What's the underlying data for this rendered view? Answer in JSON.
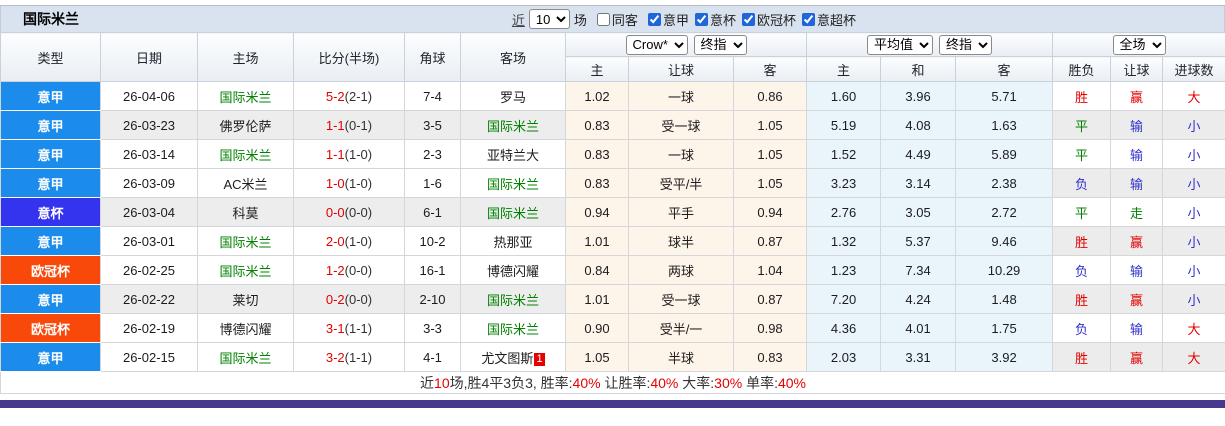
{
  "title": "国际米兰",
  "controls": {
    "recent_label": "近",
    "matches_select": "10",
    "matches_label": "场",
    "same_venue_label": "同客",
    "same_venue_checked": false,
    "leagues": [
      {
        "label": "意甲",
        "checked": true
      },
      {
        "label": "意杯",
        "checked": true
      },
      {
        "label": "欧冠杯",
        "checked": true
      },
      {
        "label": "意超杯",
        "checked": true
      }
    ]
  },
  "header": {
    "static_cols": [
      "类型",
      "日期",
      "主场",
      "比分(半场)",
      "角球",
      "客场"
    ],
    "odds_group": {
      "bookmaker_select": "Crow*",
      "stage_select": "终指",
      "cols": [
        "主",
        "让球",
        "客"
      ]
    },
    "europe_group": {
      "avg_select": "平均值",
      "stage_select": "终指",
      "cols": [
        "主",
        "和",
        "客"
      ]
    },
    "result_group": {
      "scope_select": "全场",
      "cols": [
        "胜负",
        "让球",
        "进球数"
      ]
    }
  },
  "colors": {
    "red": "#e40000",
    "green": "#008000",
    "blue": "#3030cc",
    "league_serie_a": "#1b8ceb",
    "league_coppa": "#3434ee",
    "league_ucl": "#f8490b",
    "bottom_bar": "#473a8c"
  },
  "rows": [
    {
      "league": "意甲",
      "league_color": "#1b8ceb",
      "date": "26-04-06",
      "home": "国际米兰",
      "home_team": true,
      "score": "5-2",
      "half": "(2-1)",
      "corner": "7-4",
      "away": "罗马",
      "away_team": false,
      "away_rank": "",
      "crow": [
        "1.02",
        "一球",
        "0.86"
      ],
      "avg": [
        "1.60",
        "3.96",
        "5.71"
      ],
      "results": [
        {
          "text": "胜",
          "color": "#e40000"
        },
        {
          "text": "赢",
          "color": "#e40000"
        },
        {
          "text": "大",
          "color": "#e40000"
        }
      ]
    },
    {
      "league": "意甲",
      "league_color": "#1b8ceb",
      "date": "26-03-23",
      "home": "佛罗伦萨",
      "home_team": false,
      "score": "1-1",
      "half": "(0-1)",
      "corner": "3-5",
      "away": "国际米兰",
      "away_team": true,
      "away_rank": "",
      "crow": [
        "0.83",
        "受一球",
        "1.05"
      ],
      "avg": [
        "5.19",
        "4.08",
        "1.63"
      ],
      "results": [
        {
          "text": "平",
          "color": "#008000"
        },
        {
          "text": "输",
          "color": "#3030cc"
        },
        {
          "text": "小",
          "color": "#3030cc"
        }
      ]
    },
    {
      "league": "意甲",
      "league_color": "#1b8ceb",
      "date": "26-03-14",
      "home": "国际米兰",
      "home_team": true,
      "score": "1-1",
      "half": "(1-0)",
      "corner": "2-3",
      "away": "亚特兰大",
      "away_team": false,
      "away_rank": "",
      "crow": [
        "0.83",
        "一球",
        "1.05"
      ],
      "avg": [
        "1.52",
        "4.49",
        "5.89"
      ],
      "results": [
        {
          "text": "平",
          "color": "#008000"
        },
        {
          "text": "输",
          "color": "#3030cc"
        },
        {
          "text": "小",
          "color": "#3030cc"
        }
      ]
    },
    {
      "league": "意甲",
      "league_color": "#1b8ceb",
      "date": "26-03-09",
      "home": "AC米兰",
      "home_team": false,
      "score": "1-0",
      "half": "(1-0)",
      "corner": "1-6",
      "away": "国际米兰",
      "away_team": true,
      "away_rank": "",
      "crow": [
        "0.83",
        "受平/半",
        "1.05"
      ],
      "avg": [
        "3.23",
        "3.14",
        "2.38"
      ],
      "results": [
        {
          "text": "负",
          "color": "#3030cc"
        },
        {
          "text": "输",
          "color": "#3030cc"
        },
        {
          "text": "小",
          "color": "#3030cc"
        }
      ]
    },
    {
      "league": "意杯",
      "league_color": "#3434ee",
      "date": "26-03-04",
      "home": "科莫",
      "home_team": false,
      "score": "0-0",
      "half": "(0-0)",
      "corner": "6-1",
      "away": "国际米兰",
      "away_team": true,
      "away_rank": "",
      "crow": [
        "0.94",
        "平手",
        "0.94"
      ],
      "avg": [
        "2.76",
        "3.05",
        "2.72"
      ],
      "results": [
        {
          "text": "平",
          "color": "#008000"
        },
        {
          "text": "走",
          "color": "#008000"
        },
        {
          "text": "小",
          "color": "#3030cc"
        }
      ]
    },
    {
      "league": "意甲",
      "league_color": "#1b8ceb",
      "date": "26-03-01",
      "home": "国际米兰",
      "home_team": true,
      "score": "2-0",
      "half": "(1-0)",
      "corner": "10-2",
      "away": "热那亚",
      "away_team": false,
      "away_rank": "",
      "crow": [
        "1.01",
        "球半",
        "0.87"
      ],
      "avg": [
        "1.32",
        "5.37",
        "9.46"
      ],
      "results": [
        {
          "text": "胜",
          "color": "#e40000"
        },
        {
          "text": "赢",
          "color": "#e40000"
        },
        {
          "text": "小",
          "color": "#3030cc"
        }
      ]
    },
    {
      "league": "欧冠杯",
      "league_color": "#f8490b",
      "date": "26-02-25",
      "home": "国际米兰",
      "home_team": true,
      "score": "1-2",
      "half": "(0-0)",
      "corner": "16-1",
      "away": "博德闪耀",
      "away_team": false,
      "away_rank": "",
      "crow": [
        "0.84",
        "两球",
        "1.04"
      ],
      "avg": [
        "1.23",
        "7.34",
        "10.29"
      ],
      "results": [
        {
          "text": "负",
          "color": "#3030cc"
        },
        {
          "text": "输",
          "color": "#3030cc"
        },
        {
          "text": "小",
          "color": "#3030cc"
        }
      ]
    },
    {
      "league": "意甲",
      "league_color": "#1b8ceb",
      "date": "26-02-22",
      "home": "莱切",
      "home_team": false,
      "score": "0-2",
      "half": "(0-0)",
      "corner": "2-10",
      "away": "国际米兰",
      "away_team": true,
      "away_rank": "",
      "crow": [
        "1.01",
        "受一球",
        "0.87"
      ],
      "avg": [
        "7.20",
        "4.24",
        "1.48"
      ],
      "results": [
        {
          "text": "胜",
          "color": "#e40000"
        },
        {
          "text": "赢",
          "color": "#e40000"
        },
        {
          "text": "小",
          "color": "#3030cc"
        }
      ]
    },
    {
      "league": "欧冠杯",
      "league_color": "#f8490b",
      "date": "26-02-19",
      "home": "博德闪耀",
      "home_team": false,
      "score": "3-1",
      "half": "(1-1)",
      "corner": "3-3",
      "away": "国际米兰",
      "away_team": true,
      "away_rank": "",
      "crow": [
        "0.90",
        "受半/一",
        "0.98"
      ],
      "avg": [
        "4.36",
        "4.01",
        "1.75"
      ],
      "results": [
        {
          "text": "负",
          "color": "#3030cc"
        },
        {
          "text": "输",
          "color": "#3030cc"
        },
        {
          "text": "大",
          "color": "#e40000"
        }
      ]
    },
    {
      "league": "意甲",
      "league_color": "#1b8ceb",
      "date": "26-02-15",
      "home": "国际米兰",
      "home_team": true,
      "score": "3-2",
      "half": "(1-1)",
      "corner": "4-1",
      "away": "尤文图斯",
      "away_team": false,
      "away_rank": "1",
      "crow": [
        "1.05",
        "半球",
        "0.83"
      ],
      "avg": [
        "2.03",
        "3.31",
        "3.92"
      ],
      "results": [
        {
          "text": "胜",
          "color": "#e40000"
        },
        {
          "text": "赢",
          "color": "#e40000"
        },
        {
          "text": "大",
          "color": "#e40000"
        }
      ]
    }
  ],
  "footer": {
    "segments": [
      {
        "text": "近",
        "red": false
      },
      {
        "text": "10",
        "red": true
      },
      {
        "text": "场,胜4平3负3, 胜率:",
        "red": false
      },
      {
        "text": "40%",
        "red": true
      },
      {
        "text": " 让胜率:",
        "red": false
      },
      {
        "text": "40%",
        "red": true
      },
      {
        "text": " 大率:",
        "red": false
      },
      {
        "text": "30%",
        "red": true
      },
      {
        "text": " 单率:",
        "red": false
      },
      {
        "text": "40%",
        "red": true
      }
    ]
  }
}
